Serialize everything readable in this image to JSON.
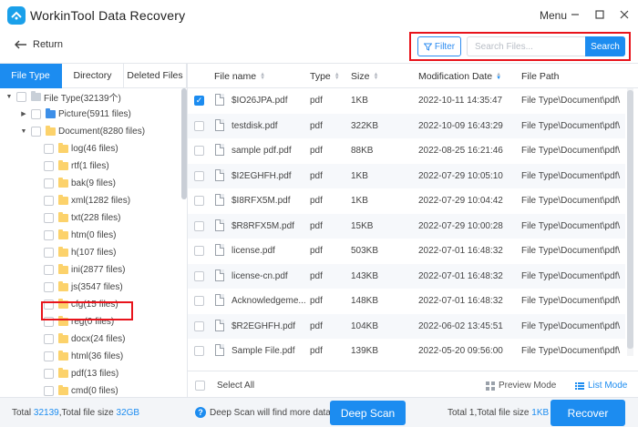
{
  "app": {
    "title": "WorkinTool Data Recovery",
    "menu_label": "Menu"
  },
  "toolbar": {
    "return_label": "Return",
    "filter_label": "Filter",
    "search_placeholder": "Search Files...",
    "search_value": "",
    "search_button": "Search"
  },
  "left_tabs": [
    "File Type",
    "Directory",
    "Deleted Files"
  ],
  "tree": [
    {
      "label": "File Type(32139个)",
      "level": 0,
      "caret": "down",
      "icon": "gray"
    },
    {
      "label": "Picture(5911 files)",
      "level": 1,
      "caret": "right",
      "icon": "blue"
    },
    {
      "label": "Document(8280 files)",
      "level": 1,
      "caret": "down",
      "icon": "yellow"
    },
    {
      "label": "log(46 files)",
      "level": 2,
      "icon": "yellow"
    },
    {
      "label": "rtf(1 files)",
      "level": 2,
      "icon": "yellow"
    },
    {
      "label": "bak(9 files)",
      "level": 2,
      "icon": "yellow"
    },
    {
      "label": "xml(1282 files)",
      "level": 2,
      "icon": "yellow"
    },
    {
      "label": "txt(228 files)",
      "level": 2,
      "icon": "yellow"
    },
    {
      "label": "htm(0 files)",
      "level": 2,
      "icon": "yellow"
    },
    {
      "label": "h(107 files)",
      "level": 2,
      "icon": "yellow"
    },
    {
      "label": "ini(2877 files)",
      "level": 2,
      "icon": "yellow"
    },
    {
      "label": "js(3547 files)",
      "level": 2,
      "icon": "yellow"
    },
    {
      "label": "cfg(15 files)",
      "level": 2,
      "icon": "yellow"
    },
    {
      "label": "reg(0 files)",
      "level": 2,
      "icon": "yellow"
    },
    {
      "label": "docx(24 files)",
      "level": 2,
      "icon": "yellow"
    },
    {
      "label": "html(36 files)",
      "level": 2,
      "icon": "yellow"
    },
    {
      "label": "pdf(13 files)",
      "level": 2,
      "icon": "yellow"
    },
    {
      "label": "cmd(0 files)",
      "level": 2,
      "icon": "yellow"
    }
  ],
  "table": {
    "columns": [
      "File name",
      "Type",
      "Size",
      "Modification Date",
      "File Path"
    ],
    "rows": [
      {
        "name": "$IO26JPA.pdf",
        "type": "pdf",
        "size": "1KB",
        "date": "2022-10-11 14:35:47",
        "path": "File Type\\Document\\pdf\\",
        "checked": true
      },
      {
        "name": "testdisk.pdf",
        "type": "pdf",
        "size": "322KB",
        "date": "2022-10-09 16:43:29",
        "path": "File Type\\Document\\pdf\\",
        "checked": false
      },
      {
        "name": "sample pdf.pdf",
        "type": "pdf",
        "size": "88KB",
        "date": "2022-08-25 16:21:46",
        "path": "File Type\\Document\\pdf\\",
        "checked": false
      },
      {
        "name": "$I2EGHFH.pdf",
        "type": "pdf",
        "size": "1KB",
        "date": "2022-07-29 10:05:10",
        "path": "File Type\\Document\\pdf\\",
        "checked": false
      },
      {
        "name": "$I8RFX5M.pdf",
        "type": "pdf",
        "size": "1KB",
        "date": "2022-07-29 10:04:42",
        "path": "File Type\\Document\\pdf\\",
        "checked": false
      },
      {
        "name": "$R8RFX5M.pdf",
        "type": "pdf",
        "size": "15KB",
        "date": "2022-07-29 10:00:28",
        "path": "File Type\\Document\\pdf\\",
        "checked": false
      },
      {
        "name": "license.pdf",
        "type": "pdf",
        "size": "503KB",
        "date": "2022-07-01 16:48:32",
        "path": "File Type\\Document\\pdf\\",
        "checked": false
      },
      {
        "name": "license-cn.pdf",
        "type": "pdf",
        "size": "143KB",
        "date": "2022-07-01 16:48:32",
        "path": "File Type\\Document\\pdf\\",
        "checked": false
      },
      {
        "name": "Acknowledgeme...",
        "type": "pdf",
        "size": "148KB",
        "date": "2022-07-01 16:48:32",
        "path": "File Type\\Document\\pdf\\",
        "checked": false
      },
      {
        "name": "$R2EGHFH.pdf",
        "type": "pdf",
        "size": "104KB",
        "date": "2022-06-02 13:45:51",
        "path": "File Type\\Document\\pdf\\",
        "checked": false
      },
      {
        "name": "Sample File.pdf",
        "type": "pdf",
        "size": "139KB",
        "date": "2022-05-20 09:56:00",
        "path": "File Type\\Document\\pdf\\",
        "checked": false
      }
    ],
    "select_all": "Select All",
    "preview_mode": "Preview Mode",
    "list_mode": "List Mode"
  },
  "status": {
    "total_prefix": "Total ",
    "total_count": "32139",
    "total_mid": ",Total file size ",
    "total_size": "32GB",
    "deep_note": "Deep Scan will find more data",
    "deep_scan": "Deep Scan",
    "selected_prefix": "Total 1,Total file size ",
    "selected_size": "1KB",
    "recover": "Recover"
  },
  "colors": {
    "accent": "#1c8cf0",
    "highlight_box": "#e8141c",
    "folder": "#fcd26b"
  }
}
